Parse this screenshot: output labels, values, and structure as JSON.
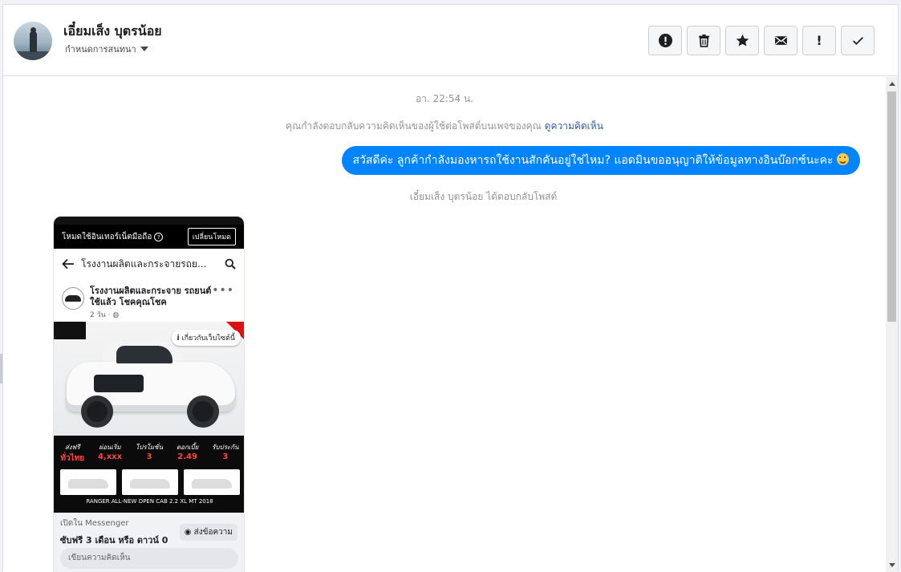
{
  "header": {
    "contact_name": "เอี๋ยมเส็ง บุตรน้อย",
    "contact_sub": "กำหนดการสนทนา",
    "toolbar": [
      {
        "icon": "alert-circle-icon",
        "label": "mark-as-spam"
      },
      {
        "icon": "trash-icon",
        "label": "delete"
      },
      {
        "icon": "star-icon",
        "label": "star"
      },
      {
        "icon": "envelope-icon",
        "label": "mark-unread"
      },
      {
        "icon": "exclamation-icon",
        "label": "priority",
        "glyph": "!"
      },
      {
        "icon": "check-icon",
        "label": "done"
      }
    ]
  },
  "chat": {
    "timestamp": "อา. 22:54 น.",
    "notice_text": "คุณกำลังตอบกลับความคิดเห็นของผู้ใช้ต่อโพสต์บนเพจของคุณ",
    "notice_link": "ดูความคิดเห็น",
    "outgoing_message": "สวัสดีค่ะ ลูกค้ากำลังมองหารถใช้งานสักคันอยู่ใช่ไหม? แอดมินขออนุญาติให้ข้อมูลทางอินบ๊อกซ์นะคะ",
    "bubble_color": "#0084ff",
    "reply_note": "เอี๋ยมเส็ง บุตรน้อย ได้ตอบกลับโพสต์"
  },
  "shared_post": {
    "mode_text": "โหมดใช้อินเทอร์เน็ตมือถือ",
    "mode_switch": "เปลี่ยนโหมด",
    "nav_title": "โรงงานผลิตและกระจายรถย...",
    "page_name": "โรงงานผลิตและกระจาย รถยนต์ใช้แล้ว โชคคุณโชค",
    "page_meta": "2 วัน · ",
    "about_label": "เกี่ยวกับเว็บไซต์นี้",
    "promo": [
      {
        "top": "ส่งฟรี",
        "value": "ทั่วไทย"
      },
      {
        "top": "ผ่อนเริ่ม",
        "value": "4,xxx"
      },
      {
        "top": "โปรโมชั่น",
        "value": "3"
      },
      {
        "top": "ดอกเบี้ย",
        "value": "2.49"
      },
      {
        "top": "รับประกัน",
        "value": "3"
      }
    ],
    "model": "RANGER ALL-NEW OPEN CAB 2.2 XL MT 2018",
    "open_in": "เปิดใน Messenger",
    "cta": "ซับฟรี 3 เดือน หรือ ดาวน์ 0",
    "send_label": "ส่งข้อความ",
    "comment_placeholder": "เขียนความคิดเห็น"
  }
}
